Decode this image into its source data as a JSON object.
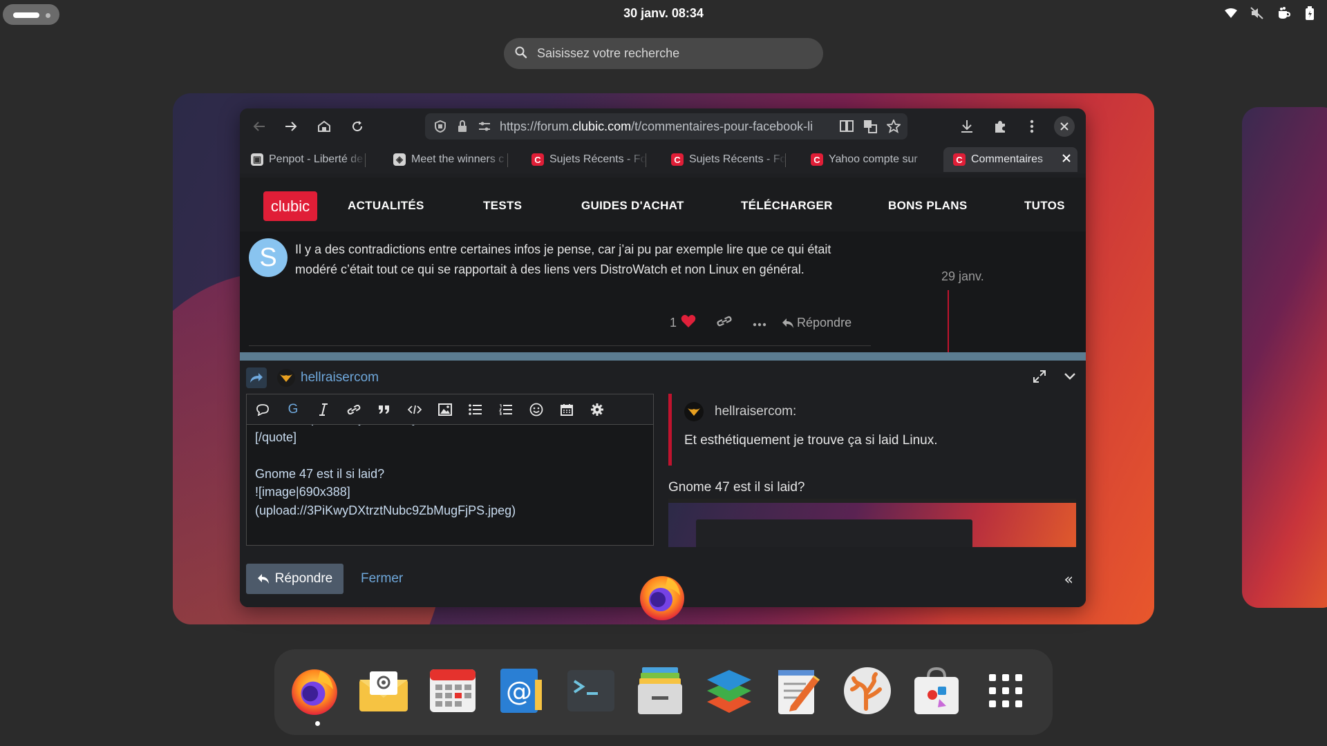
{
  "topbar": {
    "clock": "30 janv.  08:34",
    "tray_icons": [
      "wifi-icon",
      "speaker-muted-icon",
      "cup-icon",
      "battery-icon"
    ]
  },
  "search": {
    "placeholder": "Saisissez votre recherche"
  },
  "browser": {
    "url_prefix": "https://forum.",
    "url_domain": "clubic.com",
    "url_path": "/t/commentaires-pour-facebook-li",
    "tabs": [
      {
        "label": "Penpot - Liberté de",
        "icon": "penpot"
      },
      {
        "label": "Meet the winners c",
        "icon": "cube"
      },
      {
        "label": "Sujets Récents - Fo",
        "icon": "clubic"
      },
      {
        "label": "Sujets Récents - Fo",
        "icon": "clubic"
      },
      {
        "label": "Yahoo compte sur",
        "icon": "clubic"
      },
      {
        "label": "Commentaires",
        "icon": "clubic",
        "active": true
      }
    ]
  },
  "site": {
    "logo": "clubic",
    "nav": [
      "ACTUALITÉS",
      "TESTS",
      "GUIDES D'ACHAT",
      "TÉLÉCHARGER",
      "BONS PLANS",
      "TUTOS"
    ]
  },
  "post": {
    "avatar_letter": "S",
    "text": "Il y a des contradictions entre certaines infos je pense, car j’ai pu par exemple lire que ce qui était modéré c’était tout ce qui se rapportait à des liens vers DistroWatch et non Linux en général.",
    "date": "29 janv.",
    "likes": "1",
    "reply_label": "Répondre"
  },
  "composer": {
    "username": "hellraisercom",
    "editor_text": "Et esthétiquement je trouve ça si laid Linux.\n[/quote]\n\nGnome 47 est il si laid?\n![image|690x388]\n(upload://3PiKwyDXtrztNubc9ZbMugFjPS.jpeg)",
    "toolbar_bold": "G",
    "preview": {
      "quote_user": "hellraisercom:",
      "quote_text": "Et esthétiquement je trouve ça si laid Linux.",
      "heading": "Gnome 47 est il si laid?"
    },
    "reply_button": "Répondre",
    "close_button": "Fermer",
    "collapse": "«"
  },
  "dock": {
    "apps": [
      "firefox-icon",
      "mail-icon",
      "calendar-icon",
      "email-client-icon",
      "terminal-icon",
      "files-icon",
      "office-icon",
      "text-editor-icon",
      "coral-app-icon",
      "software-store-icon",
      "app-grid-icon"
    ]
  }
}
